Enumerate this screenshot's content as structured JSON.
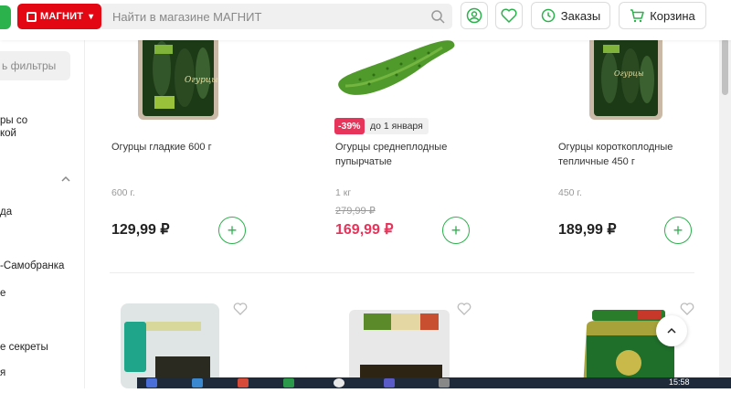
{
  "header": {
    "brand": "МАГНИТ",
    "search_placeholder": "Найти в магазине МАГНИТ",
    "orders_label": "Заказы",
    "cart_label": "Корзина"
  },
  "sidebar": {
    "filter_button": "ь фильтры",
    "items": [
      "ры со",
      "кой",
      "да",
      "-Самобранка",
      "е",
      "е секреты",
      "я"
    ]
  },
  "products": [
    {
      "name": "Огурцы гладкие 600 г",
      "weight": "600 г.",
      "price": "129,99 ₽"
    },
    {
      "name": "Огурцы среднеплодные пупырчатые",
      "weight": "1 кг",
      "old_price": "279,99 ₽",
      "price": "169,99 ₽",
      "discount": "-39%",
      "promo": "до 1 января"
    },
    {
      "name": "Огурцы короткоплодные тепличные 450 г",
      "weight": "450 г.",
      "price": "189,99 ₽"
    }
  ],
  "taskbar": {
    "time": "15:58"
  },
  "colors": {
    "brand_red": "#e30613",
    "accent_green": "#2bb24c",
    "sale_pink": "#e6345a"
  }
}
